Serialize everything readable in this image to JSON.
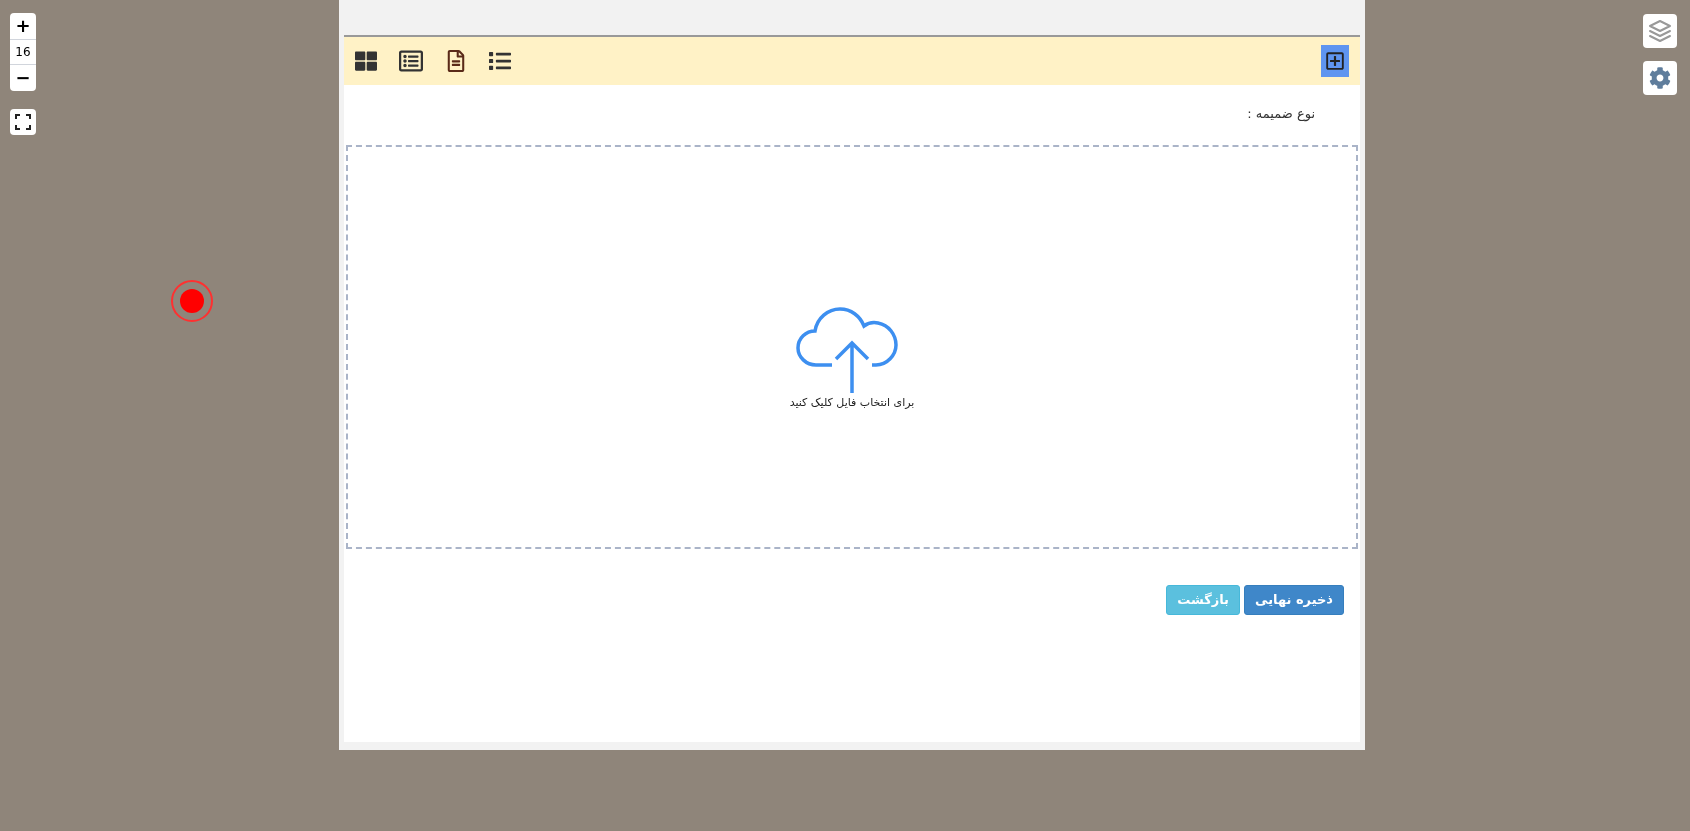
{
  "map": {
    "zoom_in": "+",
    "zoom_level": "16",
    "zoom_out": "−"
  },
  "form": {
    "attachment_type_label": "نوع ضمیمه :",
    "dropzone": {
      "hint": "برای انتخاب فایل کلیک کنید"
    },
    "buttons": [
      {
        "kind": "primary",
        "label": "ذخیره نهایی"
      },
      {
        "kind": "secondary",
        "label": "بازگشت"
      }
    ]
  }
}
